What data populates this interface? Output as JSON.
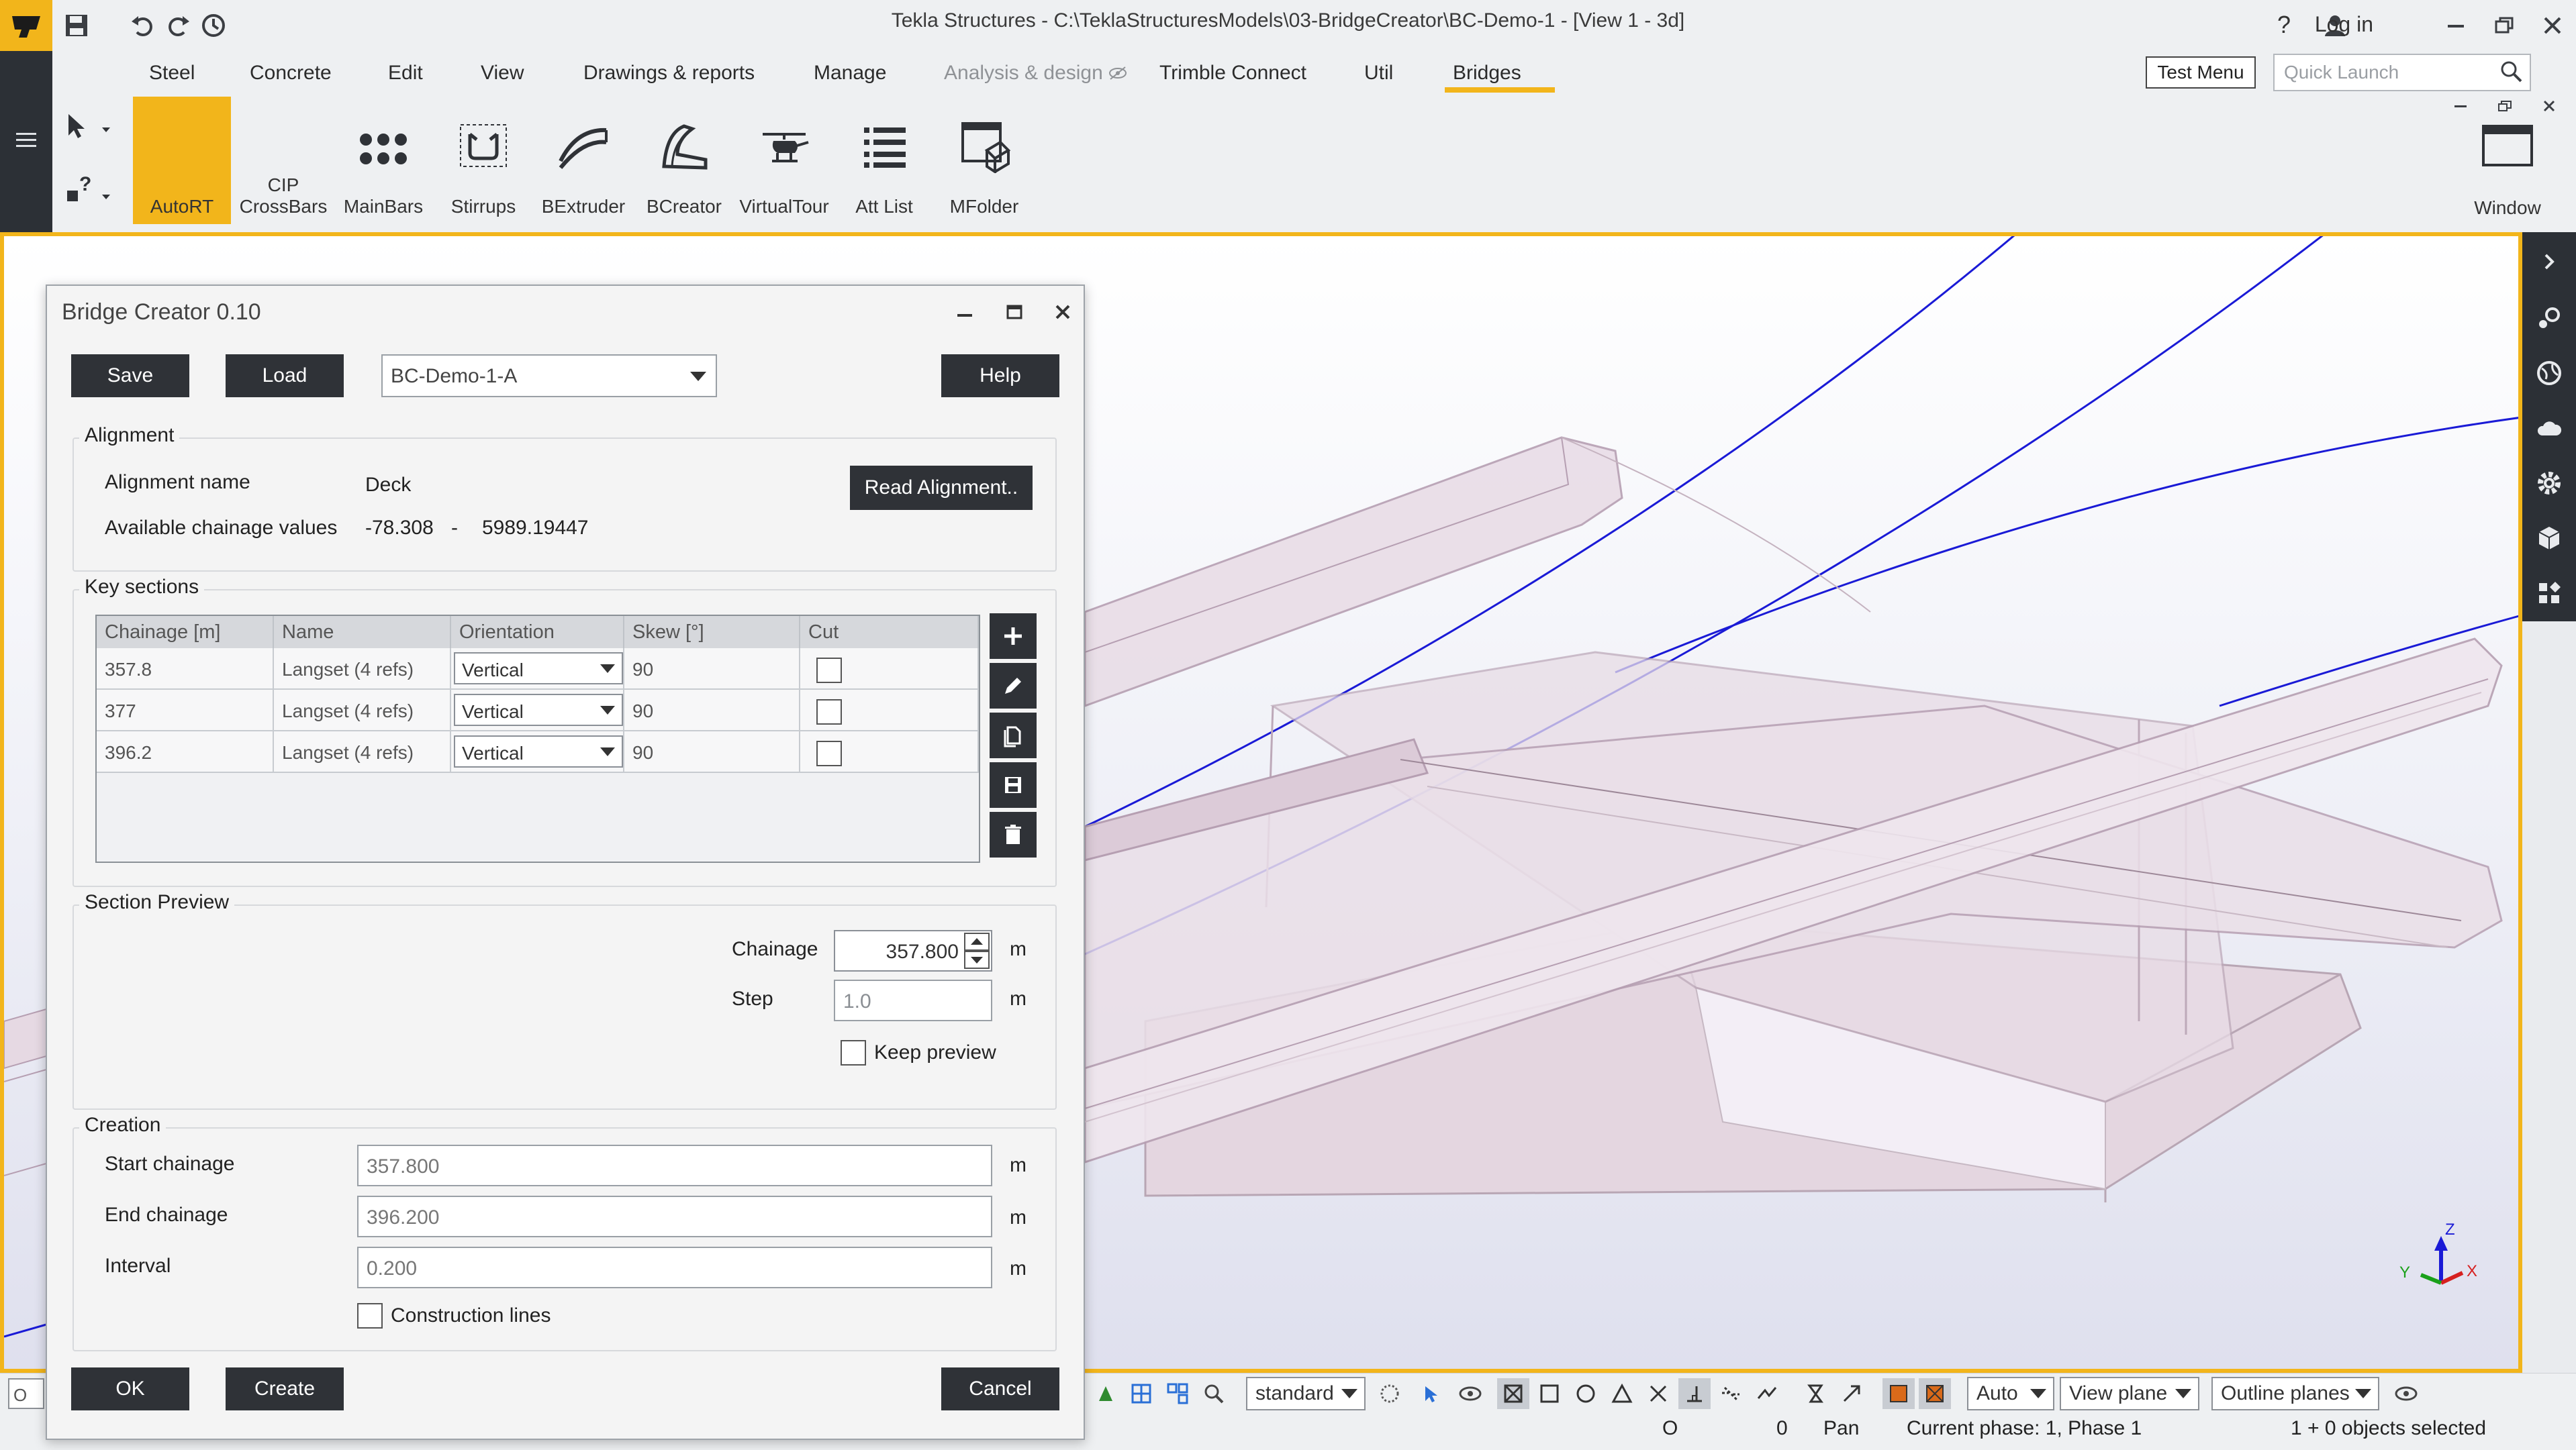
{
  "app": {
    "title": "Tekla Structures - C:\\TeklaStructuresModels\\03-BridgeCreator\\BC-Demo-1  - [View 1 - 3d]",
    "login_label": "Log in",
    "help_glyph": "?"
  },
  "menu": {
    "items": [
      "Steel",
      "Concrete",
      "Edit",
      "View",
      "Drawings & reports",
      "Manage",
      "Analysis & design",
      "Trimble Connect",
      "Util",
      "Bridges"
    ],
    "active": "Bridges",
    "test_menu": "Test Menu",
    "quick_launch_placeholder": "Quick Launch"
  },
  "ribbon": {
    "buttons": [
      {
        "label": "AutoRT",
        "icon": "autort-icon",
        "active": true
      },
      {
        "label": "CIP CrossBars",
        "icon": "crossbars-icon"
      },
      {
        "label": "MainBars",
        "icon": "mainbars-icon"
      },
      {
        "label": "Stirrups",
        "icon": "stirrups-icon"
      },
      {
        "label": "BExtruder",
        "icon": "bextruder-icon"
      },
      {
        "label": "BCreator",
        "icon": "bcreator-icon"
      },
      {
        "label": "VirtualTour",
        "icon": "helicopter-icon"
      },
      {
        "label": "Att List",
        "icon": "list-icon"
      },
      {
        "label": "MFolder",
        "icon": "folder-icon"
      }
    ],
    "window_label": "Window",
    "cip_line1": "CIP",
    "cip_line2": "CrossBars"
  },
  "dialog": {
    "title": "Bridge Creator 0.10",
    "save": "Save",
    "load": "Load",
    "preset": "BC-Demo-1-A",
    "help": "Help",
    "alignment": {
      "group": "Alignment",
      "name_label": "Alignment name",
      "name_value": "Deck",
      "chainage_label": "Available chainage values",
      "chainage_min": "-78.308",
      "chainage_sep": "-",
      "chainage_max": "5989.19447",
      "read_button": "Read Alignment.."
    },
    "key_sections": {
      "group": "Key sections",
      "columns": [
        "Chainage [m]",
        "Name",
        "Orientation",
        "Skew [°]",
        "Cut"
      ],
      "rows": [
        {
          "chainage": "357.8",
          "name": "Langset (4 refs)",
          "orientation": "Vertical",
          "skew": "90",
          "cut": false
        },
        {
          "chainage": "377",
          "name": "Langset (4 refs)",
          "orientation": "Vertical",
          "skew": "90",
          "cut": false
        },
        {
          "chainage": "396.2",
          "name": "Langset (4 refs)",
          "orientation": "Vertical",
          "skew": "90",
          "cut": false
        }
      ]
    },
    "preview": {
      "group": "Section Preview",
      "chainage_label": "Chainage",
      "chainage_value": "357.800",
      "step_label": "Step",
      "step_value": "1.0",
      "unit": "m",
      "keep_preview": "Keep preview"
    },
    "creation": {
      "group": "Creation",
      "start_label": "Start chainage",
      "start_value": "357.800",
      "end_label": "End chainage",
      "end_value": "396.200",
      "interval_label": "Interval",
      "interval_value": "0.200",
      "unit": "m",
      "construction_lines": "Construction lines"
    },
    "ok": "OK",
    "create": "Create",
    "cancel": "Cancel"
  },
  "bottom_bar": {
    "left_input": "O N",
    "view_select": "standard",
    "auto_select": "Auto",
    "plane_select": "View plane",
    "outline_select": "Outline planes",
    "status_o": "O",
    "status_zero": "0",
    "status_pan": "Pan",
    "status_phase": "Current phase: 1, Phase 1",
    "status_selected": "1 + 0 objects selected"
  },
  "colors": {
    "accent": "#f2b51b",
    "dark": "#2f3237",
    "alignment_line": "#1a1ad6"
  }
}
